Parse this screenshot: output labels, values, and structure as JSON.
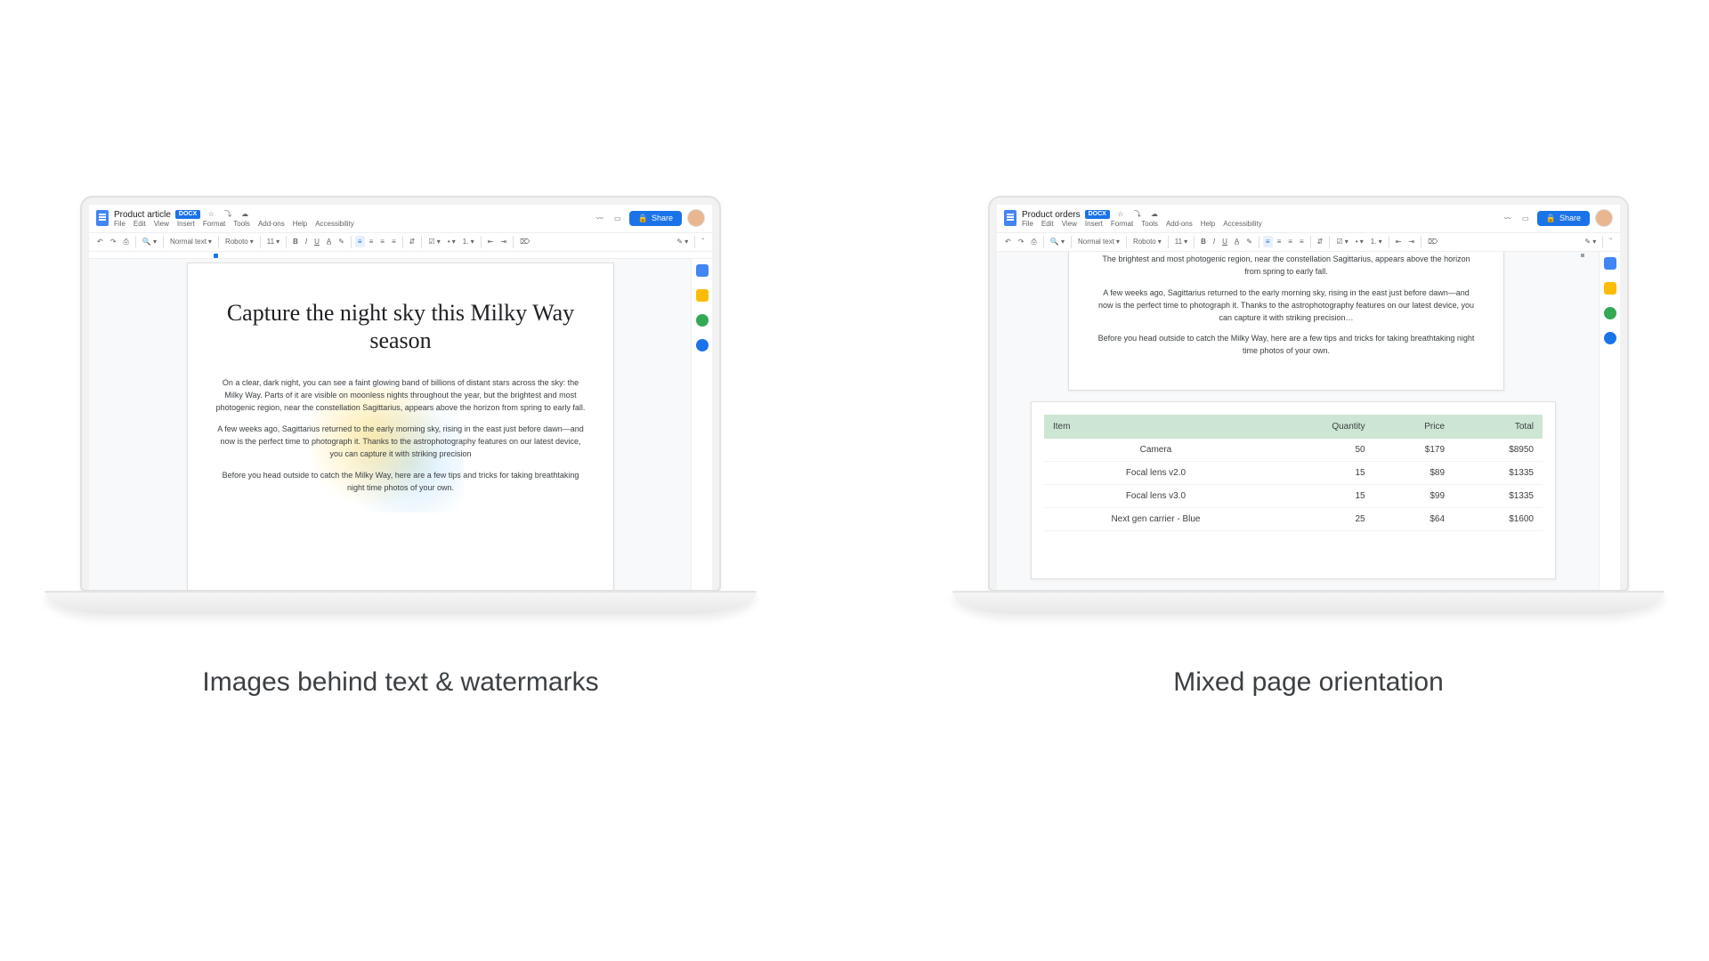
{
  "captions": {
    "left": "Images behind text & watermarks",
    "right": "Mixed page orientation"
  },
  "shareLabel": "Share",
  "docA": {
    "title": "Product article",
    "badge": "DOCX",
    "menus": [
      "File",
      "Edit",
      "View",
      "Insert",
      "Format",
      "Tools",
      "Add-ons",
      "Help",
      "Accessibility"
    ],
    "styleName": "Normal text",
    "font": "Roboto",
    "fontSize": "11",
    "heading": "Capture the night sky this Milky Way season",
    "p1": "On a clear, dark night, you can see a faint glowing band of billions of distant stars across the sky: the Milky Way. Parts of it are visible on moonless nights throughout the year, but the brightest and most photogenic region, near the constellation Sagittarius, appears above the horizon from spring to early fall.",
    "p2": "A few weeks ago, Sagittarius returned to the early morning sky, rising in the east just before dawn—and now is the perfect time to photograph it. Thanks to the astrophotography features on our latest device, you can capture it with striking precision",
    "p3": "Before you head outside to catch the Milky Way, here are a few tips and tricks for taking breathtaking night time photos of your own."
  },
  "docB": {
    "title": "Product orders",
    "badge": "DOCX",
    "menus": [
      "File",
      "Edit",
      "View",
      "Insert",
      "Format",
      "Tools",
      "Add-ons",
      "Help",
      "Accessibility"
    ],
    "styleName": "Normal text",
    "font": "Roboto",
    "fontSize": "11",
    "p1": "The brightest and most photogenic region, near the constellation Sagittarius, appears above the horizon from spring to early fall.",
    "p2": "A few weeks ago, Sagittarius returned to the early morning sky, rising in the east just before dawn—and now is the perfect time to photograph it. Thanks to the astrophotography features on our latest device, you can capture it with striking precision…",
    "p3": "Before you head outside to catch the Milky Way, here are a few tips and tricks for taking breathtaking night time photos of your own.",
    "table": {
      "headers": {
        "item": "Item",
        "qty": "Quantity",
        "price": "Price",
        "total": "Total"
      },
      "rows": [
        {
          "item": "Camera",
          "qty": "50",
          "price": "$179",
          "total": "$8950"
        },
        {
          "item": "Focal lens v2.0",
          "qty": "15",
          "price": "$89",
          "total": "$1335"
        },
        {
          "item": "Focal lens v3.0",
          "qty": "15",
          "price": "$99",
          "total": "$1335"
        },
        {
          "item": "Next gen carrier - Blue",
          "qty": "25",
          "price": "$64",
          "total": "$1600"
        }
      ]
    }
  },
  "sideApps": [
    {
      "name": "calendar-icon",
      "color": "#4285f4"
    },
    {
      "name": "keep-icon",
      "color": "#fbbc04"
    },
    {
      "name": "tasks-icon",
      "color": "#34a853"
    },
    {
      "name": "contacts-icon",
      "color": "#1a73e8"
    }
  ]
}
